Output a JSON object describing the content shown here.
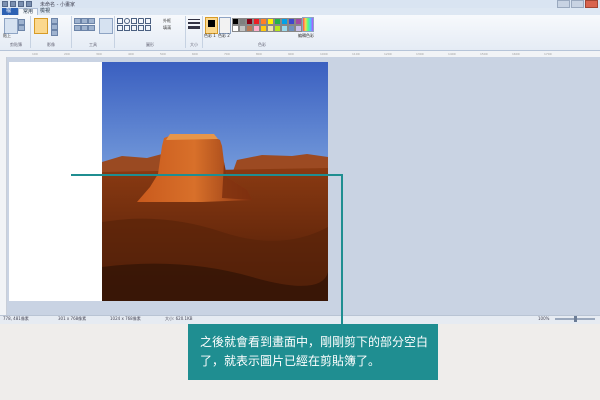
{
  "window": {
    "title": "未命名 - 小畫家"
  },
  "tabs": [
    {
      "label": "檔案"
    },
    {
      "label": "常用"
    },
    {
      "label": "檢視"
    }
  ],
  "ribbon": {
    "groups": [
      {
        "label": "剪貼簿",
        "buttons": [
          "貼上",
          "剪下",
          "複製"
        ]
      },
      {
        "label": "影像",
        "buttons": [
          "選取",
          "裁剪",
          "調整大小",
          "旋轉"
        ]
      },
      {
        "label": "工具",
        "buttons": [
          "筆刷"
        ]
      },
      {
        "label": "圖形",
        "buttons": [
          "外框",
          "填滿"
        ]
      },
      {
        "label": "大小"
      },
      {
        "label": "色彩",
        "buttons": [
          "色彩 1",
          "色彩 2",
          "編輯色彩"
        ]
      }
    ],
    "palette": [
      "#000000",
      "#7f7f7f",
      "#880015",
      "#ed1c24",
      "#ff7f27",
      "#fff200",
      "#22b14c",
      "#00a2e8",
      "#3f48cc",
      "#a349a4",
      "#ffffff",
      "#c3c3c3",
      "#b97a57",
      "#ffaec9",
      "#ffc90e",
      "#efe4b0",
      "#b5e61d",
      "#99d9ea",
      "#7092be",
      "#c8bfe7"
    ]
  },
  "ruler_ticks": [
    "100",
    "200",
    "300",
    "400",
    "500",
    "600",
    "700",
    "800",
    "900",
    "1000",
    "1100",
    "1200",
    "1300",
    "1400",
    "1500",
    "1600",
    "1700"
  ],
  "status": {
    "position": "778, 481像素",
    "selection": "301 x 768像素",
    "image_size": "1024 x 768像素",
    "file_size": "大小: 620.1KB",
    "zoom": "100%"
  },
  "callout": {
    "line1": "之後就會看到畫面中，剛剛剪下的部分空白",
    "line2": "了，就表示圖片已經在剪貼簿了。"
  }
}
